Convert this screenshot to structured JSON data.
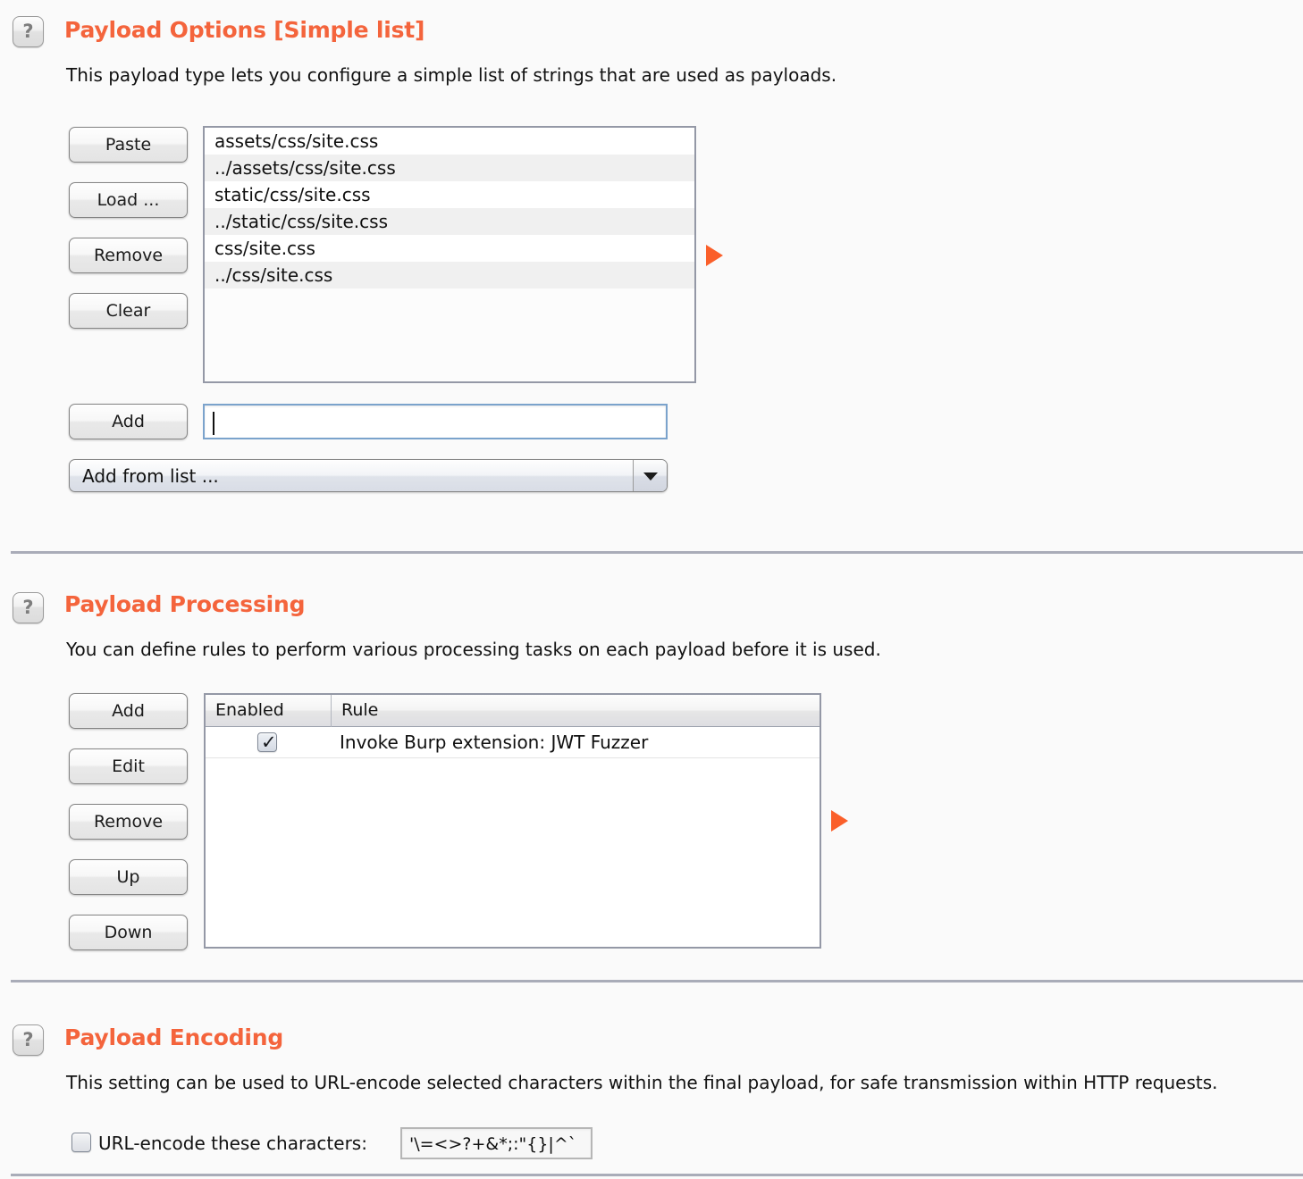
{
  "payload_options": {
    "help_icon": "question-mark-icon",
    "title": "Payload Options [Simple list]",
    "description": "This payload type lets you configure a simple list of strings that are used as payloads.",
    "buttons": [
      {
        "label": "Paste"
      },
      {
        "label": "Load ..."
      },
      {
        "label": "Remove"
      },
      {
        "label": "Clear"
      }
    ],
    "list_items": [
      "assets/css/site.css",
      "../assets/css/site.css",
      "static/css/site.css",
      "../static/css/site.css",
      "css/site.css",
      "../css/site.css"
    ],
    "add_button_label": "Add",
    "add_input_value": "",
    "add_input_placeholder": "",
    "add_from_list_label": "Add from list ...",
    "marker_icon": "play-triangle-icon"
  },
  "payload_processing": {
    "help_icon": "question-mark-icon",
    "title": "Payload Processing",
    "description": "You can define rules to perform various processing tasks on each payload before it is used.",
    "buttons": [
      {
        "label": "Add"
      },
      {
        "label": "Edit"
      },
      {
        "label": "Remove"
      },
      {
        "label": "Up"
      },
      {
        "label": "Down"
      }
    ],
    "table": {
      "columns": [
        "Enabled",
        "Rule"
      ],
      "rows": [
        {
          "enabled": true,
          "enabled_glyph": "✓",
          "rule": "Invoke Burp extension: JWT Fuzzer"
        }
      ]
    },
    "marker_icon": "play-triangle-icon"
  },
  "payload_encoding": {
    "help_icon": "question-mark-icon",
    "title": "Payload Encoding",
    "description": "This setting can be used to URL-encode selected characters within the final payload, for safe transmission within HTTP requests.",
    "url_encode_checked": false,
    "url_encode_label": "URL-encode these characters:",
    "url_encode_characters": "'\\=<>?+&*;:\"{}|^`"
  },
  "colors": {
    "heading_orange": "#f4643c",
    "marker_orange": "#fa5f2a",
    "divider": "#a9acb8",
    "background": "#fafafa",
    "focus_border": "#7ba3cc"
  }
}
